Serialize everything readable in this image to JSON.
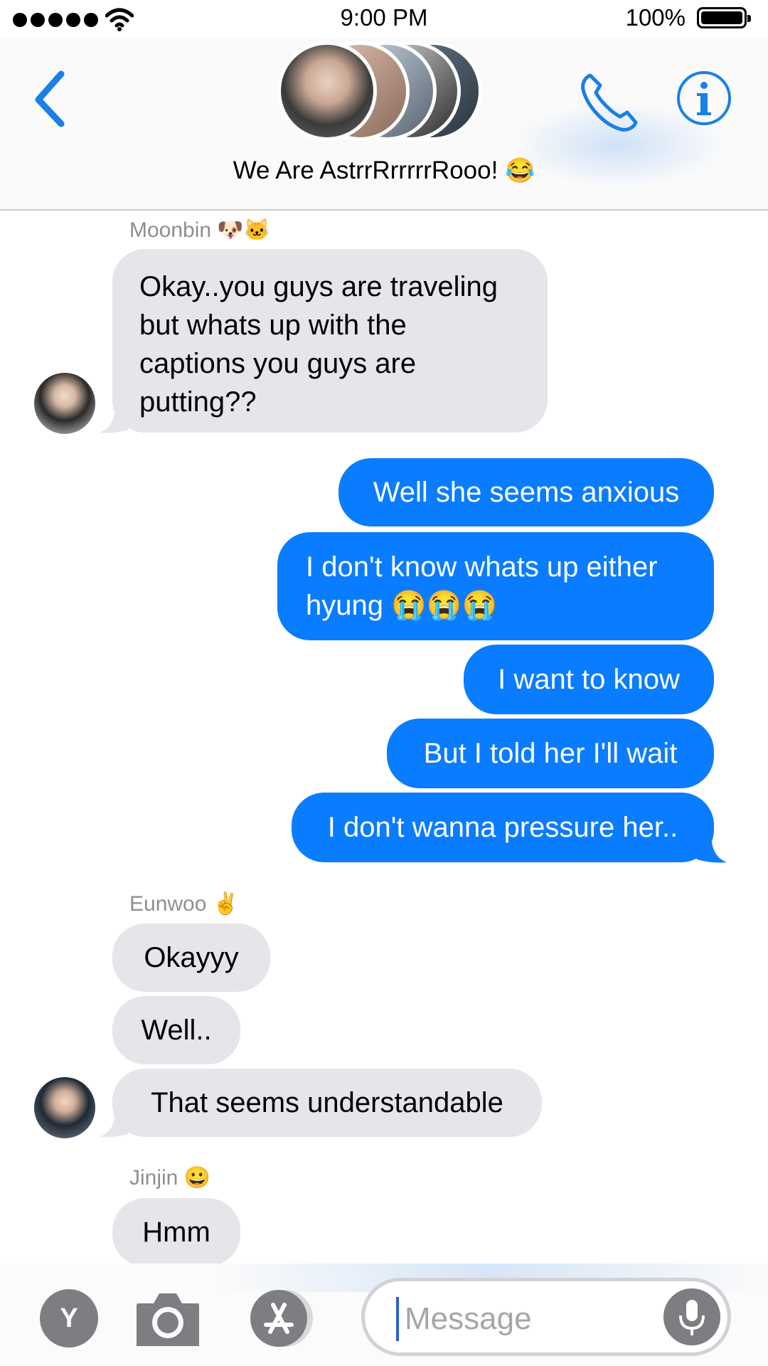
{
  "status_bar": {
    "time": "9:00 PM",
    "battery": "100%"
  },
  "header": {
    "title": "We Are AstrrRrrrrrRooo!",
    "title_emoji": "😂"
  },
  "messages": [
    {
      "sender": "Moonbin",
      "sender_emoji": "🐶🐱",
      "direction": "incoming",
      "lines": [
        "Okay..you guys are traveling",
        "but whats up with the",
        "captions you guys are",
        "putting??"
      ]
    },
    {
      "direction": "outgoing",
      "text": "Well she seems anxious"
    },
    {
      "direction": "outgoing",
      "lines": [
        "I don't know whats up either",
        "hyung 😭😭😭"
      ]
    },
    {
      "direction": "outgoing",
      "text": "I want to know"
    },
    {
      "direction": "outgoing",
      "text": "But I told her I'll wait"
    },
    {
      "direction": "outgoing",
      "text": "I don't wanna pressure her.."
    },
    {
      "sender": "Eunwoo",
      "sender_emoji": "✌️",
      "direction": "incoming",
      "text": "Okayyy"
    },
    {
      "direction": "incoming",
      "text": "Well.."
    },
    {
      "direction": "incoming",
      "text": "That seems understandable"
    },
    {
      "sender": "Jinjin",
      "sender_emoji": "😀",
      "direction": "incoming",
      "text": "Hmm"
    }
  ],
  "input_bar": {
    "apps_letter": "Y",
    "placeholder": "Message"
  },
  "colors": {
    "accent": "#0a7cff",
    "incoming_bubble": "#e5e5ea",
    "icon_blue": "#1a7fe6",
    "sender_gray": "#8e8e93"
  },
  "icons": [
    "back-chevron-icon",
    "phone-icon",
    "info-icon",
    "camera-icon",
    "app-store-icon",
    "microphone-icon",
    "wifi-icon",
    "battery-icon"
  ]
}
